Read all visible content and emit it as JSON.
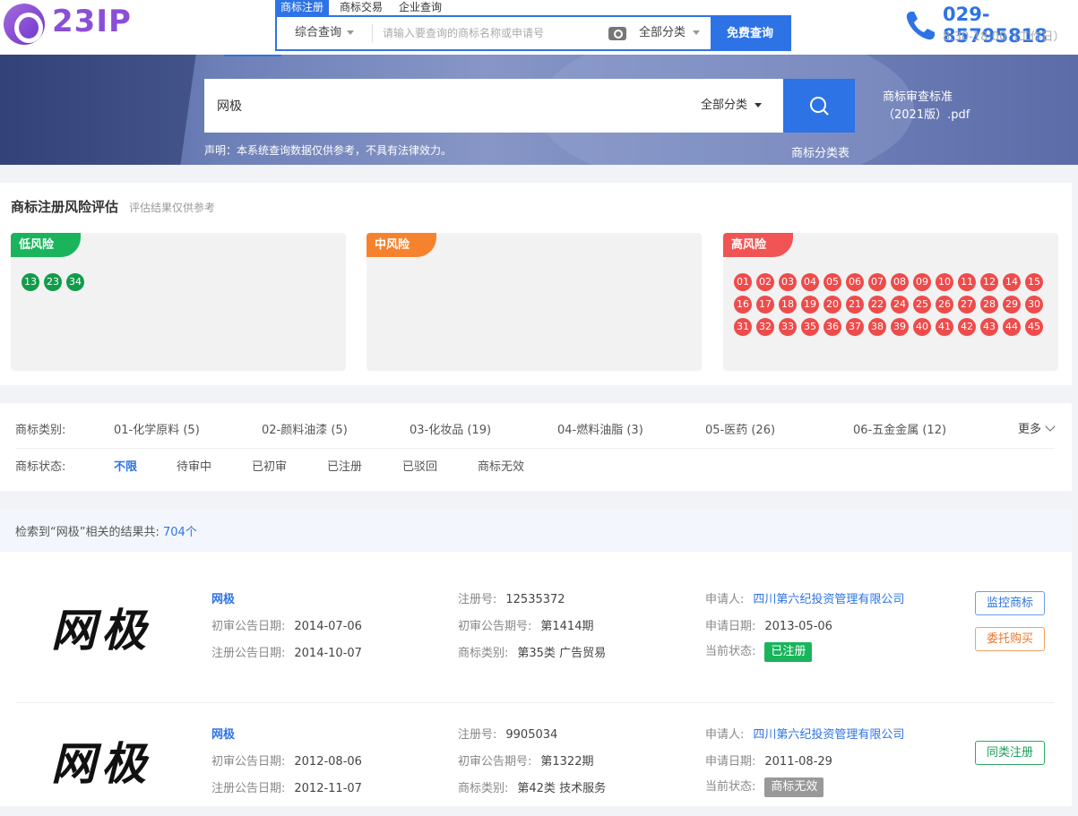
{
  "header": {
    "logo_text": "23IP",
    "top_tabs": [
      "商标注册",
      "商标交易",
      "企业查询"
    ],
    "search": {
      "type_label": "综合查询",
      "placeholder": "请输入要查询的商标名称或申请号",
      "category_label": "全部分类",
      "button_label": "免费查询"
    },
    "phone": "029-85795818",
    "hours": "8:30-18:00（工作日）"
  },
  "banner": {
    "search_value": "网极",
    "category_label": "全部分类",
    "disclaimer": "声明：本系统查询数据仅供参考，不具有法律效力。",
    "pdf_link": "商标审查标准（2021版）.pdf",
    "class_table_link": "商标分类表"
  },
  "risk": {
    "title": "商标注册风险评估",
    "subtitle": "评估结果仅供参考",
    "low_label": "低风险",
    "mid_label": "中风险",
    "high_label": "高风险",
    "low_classes": [
      "13",
      "23",
      "34"
    ],
    "mid_classes": [],
    "high_classes": [
      "01",
      "02",
      "03",
      "04",
      "05",
      "06",
      "07",
      "08",
      "09",
      "10",
      "11",
      "12",
      "14",
      "15",
      "16",
      "17",
      "18",
      "19",
      "20",
      "21",
      "22",
      "24",
      "25",
      "26",
      "27",
      "28",
      "29",
      "30",
      "31",
      "32",
      "33",
      "35",
      "36",
      "37",
      "38",
      "39",
      "40",
      "41",
      "42",
      "43",
      "44",
      "45"
    ],
    "colors": {
      "low": "#19b45c",
      "mid": "#f7822e",
      "high": "#f15454"
    }
  },
  "filters": {
    "category_label": "商标类别:",
    "categories": [
      "01-化学原料 (5)",
      "02-颜料油漆 (5)",
      "03-化妆品 (19)",
      "04-燃料油脂 (3)",
      "05-医药 (26)",
      "06-五金金属 (12)"
    ],
    "more_label": "更多",
    "status_label": "商标状态:",
    "statuses": [
      "不限",
      "待审中",
      "已初审",
      "已注册",
      "已驳回",
      "商标无效"
    ],
    "active_status": "不限"
  },
  "results": {
    "summary_prefix": "检索到“网极”相关的结果共:",
    "count": "704个",
    "labels": {
      "first_trial_date": "初审公告日期:",
      "reg_pub_date": "注册公告日期:",
      "reg_no": "注册号:",
      "trial_issue": "初审公告期号:",
      "category": "商标类别:",
      "applicant": "申请人:",
      "apply_date": "申请日期:",
      "status": "当前状态:"
    },
    "items": [
      {
        "image_text": "网极",
        "name": "网极",
        "first_trial_date": "2014-07-06",
        "reg_pub_date": "2014-10-07",
        "reg_no": "12535372",
        "trial_issue": "第1414期",
        "category": "第35类 广告贸易",
        "applicant": "四川第六纪投资管理有限公司",
        "apply_date": "2013-05-06",
        "status": "已注册",
        "buttons": [
          "监控商标",
          "委托购买"
        ]
      },
      {
        "image_text": "网极",
        "name": "网极",
        "first_trial_date": "2012-08-06",
        "reg_pub_date": "2012-11-07",
        "reg_no": "9905034",
        "trial_issue": "第1322期",
        "category": "第42类 技术服务",
        "applicant": "四川第六纪投资管理有限公司",
        "apply_date": "2011-08-29",
        "status": "商标无效",
        "buttons": [
          "同类注册"
        ]
      }
    ]
  }
}
